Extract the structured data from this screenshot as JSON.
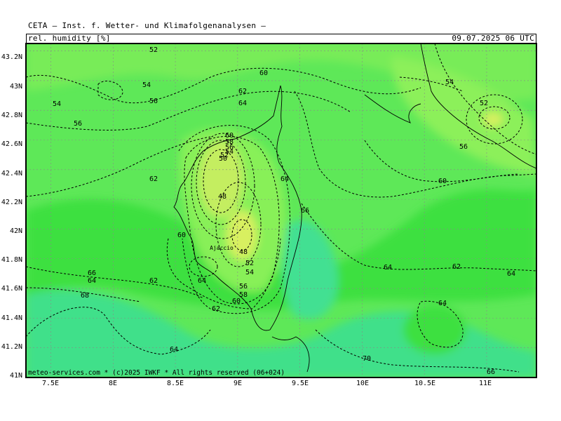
{
  "header": {
    "title": "CETA — Inst. f. Wetter- und Klimafolgenanalysen —",
    "parameter": "rel. humidity [%]",
    "valid_time": "09.07.2025 06 UTC"
  },
  "footer": {
    "credit": "meteo-services.com * (c)2025 IWKF * All rights reserved (06+024)"
  },
  "axes": {
    "lat_labels": [
      "43.2N",
      "43N",
      "42.8N",
      "42.6N",
      "42.4N",
      "42.2N",
      "42N",
      "41.8N",
      "41.6N",
      "41.4N",
      "41.2N",
      "41N"
    ],
    "lon_labels": [
      "7.5E",
      "8E",
      "8.5E",
      "9E",
      "9.5E",
      "10E",
      "10.5E",
      "11E"
    ]
  },
  "map": {
    "region": "Corsica and surrounding sea",
    "lat_range": [
      41.0,
      43.25
    ],
    "lon_range": [
      7.3,
      11.4
    ],
    "grid": true,
    "contour_interval_percent": 2,
    "contour_labels": [
      "52",
      "54",
      "56",
      "54",
      "56",
      "60",
      "62",
      "64",
      "60",
      "58",
      "56",
      "54",
      "52",
      "50",
      "62",
      "48",
      "64",
      "66",
      "60",
      "48",
      "52",
      "54",
      "56",
      "58",
      "60",
      "62",
      "64",
      "66",
      "64",
      "62",
      "68",
      "64",
      "64",
      "62",
      "64",
      "70",
      "66",
      "54",
      "52",
      "56",
      "60",
      "64"
    ],
    "city_label": "Ajaccio",
    "colors": {
      "dry_yellow": "#d8f060",
      "light_green": "#88f058",
      "mid_green": "#5ee858",
      "bright_green": "#3ce040",
      "teal_green": "#40e08a",
      "contour": "#000000",
      "grid": "#888888"
    }
  }
}
